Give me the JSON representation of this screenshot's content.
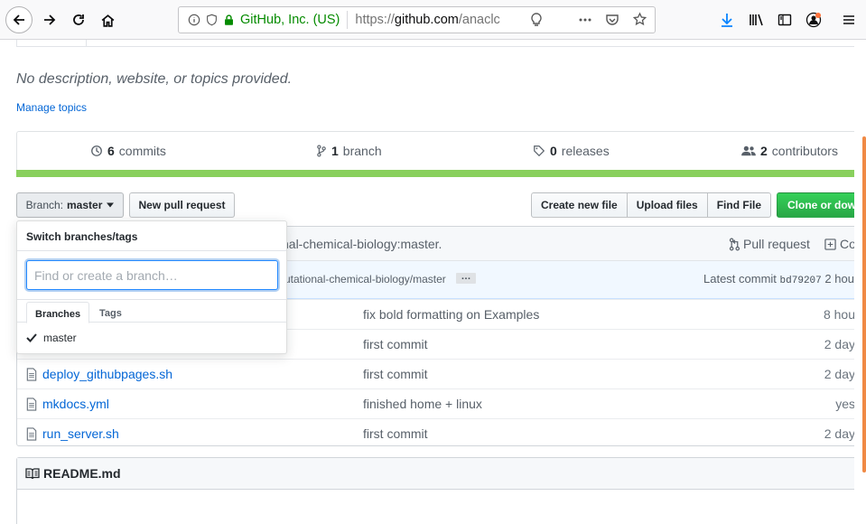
{
  "browser": {
    "identity": "GitHub, Inc. (US)",
    "url_scheme": "https://",
    "url_host": "github.com",
    "url_path": "/anaclc"
  },
  "repo": {
    "description": "No description, website, or topics provided.",
    "manage_topics": "Manage topics",
    "commits_count": "6",
    "commits_label": "commits",
    "branches_count": "1",
    "branches_label": "branch",
    "releases_count": "0",
    "releases_label": "releases",
    "contributors_count": "2",
    "contributors_label": "contributors",
    "language_color": "#89d05d"
  },
  "toolbar": {
    "branch_prefix": "Branch:",
    "branch_name": "master",
    "new_pull_request": "New pull request",
    "create_new_file": "Create new file",
    "upload_files": "Upload files",
    "find_file": "Find File",
    "clone": "Clone or down"
  },
  "branch_info": {
    "text": "nal-chemical-biology:master.",
    "pull_request": "Pull request",
    "compare": "Co"
  },
  "commit_tease": {
    "message": "utational-chemical-biology/master",
    "latest_label": "Latest commit",
    "sha": "bd79207",
    "age": "2 hou"
  },
  "files": [
    {
      "name": "",
      "message": "fix bold formatting on Examples",
      "age": "8 hou"
    },
    {
      "name": "",
      "message": "first commit",
      "age": "2 day"
    },
    {
      "name": "deploy_githubpages.sh",
      "message": "first commit",
      "age": "2 day"
    },
    {
      "name": "mkdocs.yml",
      "message": "finished home + linux",
      "age": "yes"
    },
    {
      "name": "run_server.sh",
      "message": "first commit",
      "age": "2 day"
    }
  ],
  "readme": {
    "title": "README.md"
  },
  "dropdown": {
    "title": "Switch branches/tags",
    "placeholder": "Find or create a branch…",
    "tab_branches": "Branches",
    "tab_tags": "Tags",
    "items": [
      "master"
    ]
  }
}
